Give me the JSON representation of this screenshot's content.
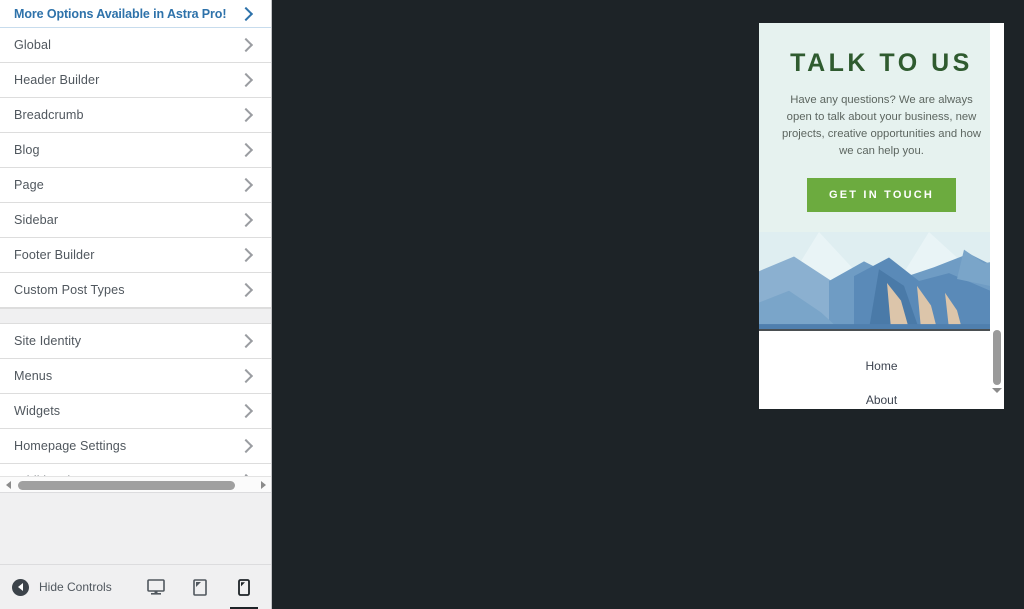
{
  "sidebar": {
    "pro_upsell": {
      "label": "More Options Available in Astra Pro!",
      "icon": "chevron-right-icon"
    },
    "group_one": [
      {
        "label": "Global"
      },
      {
        "label": "Header Builder"
      },
      {
        "label": "Breadcrumb"
      },
      {
        "label": "Blog"
      },
      {
        "label": "Page"
      },
      {
        "label": "Sidebar"
      },
      {
        "label": "Footer Builder"
      },
      {
        "label": "Custom Post Types"
      }
    ],
    "group_two": [
      {
        "label": "Site Identity"
      },
      {
        "label": "Menus"
      },
      {
        "label": "Widgets"
      },
      {
        "label": "Homepage Settings"
      },
      {
        "label": "Additional CSS"
      }
    ],
    "footer": {
      "hide_controls_label": "Hide Controls",
      "collapse_icon": "collapse-left-icon",
      "devices": [
        {
          "name": "desktop",
          "icon": "desktop-icon",
          "active": false
        },
        {
          "name": "tablet",
          "icon": "tablet-icon",
          "active": false
        },
        {
          "name": "mobile",
          "icon": "mobile-icon",
          "active": true
        }
      ]
    },
    "horizontal_scrollbar": {
      "left_arrow_icon": "arrow-left-icon",
      "right_arrow_icon": "arrow-right-icon"
    }
  },
  "preview": {
    "hero": {
      "title": "TALK TO US",
      "body": "Have any questions? We are always open to talk about your business, new projects, creative opportunities and how we can help you.",
      "cta_label": "GET IN TOUCH"
    },
    "nav_links": [
      {
        "label": "Home"
      },
      {
        "label": "About"
      }
    ],
    "scrollbar": {
      "down_arrow_icon": "arrow-down-icon"
    }
  },
  "colors": {
    "sidebar_bg": "#f0f0f1",
    "row_bg": "#ffffff",
    "row_text": "#50575e",
    "pro_link": "#2e72aa",
    "workspace_bg": "#1d2327",
    "hero_bg": "#e6f2ef",
    "hero_title": "#2f5b2f",
    "cta_green": "#6cab3f",
    "active_device_underline": "#1d2327"
  }
}
